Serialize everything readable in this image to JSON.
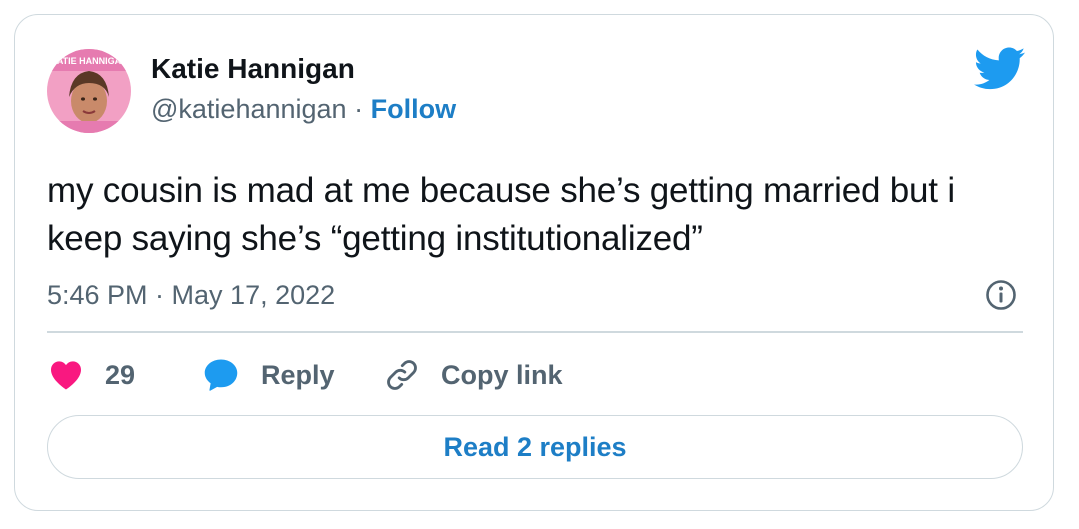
{
  "author": {
    "name": "Katie Hannigan",
    "handle": "@katiehannigan",
    "separator": "·",
    "follow_label": "Follow",
    "avatar_text": "KATIE HANNIGAN"
  },
  "tweet": {
    "text": "my cousin is mad at me because she’s getting married but i keep saying she’s “getting institutionalized”",
    "timestamp": "5:46 PM · May 17, 2022"
  },
  "actions": {
    "like_count": "29",
    "reply_label": "Reply",
    "copy_link_label": "Copy link"
  },
  "read_replies_label": "Read 2 replies",
  "colors": {
    "accent": "#1d7ec6",
    "like": "#f91880",
    "reply": "#1d9bf0",
    "border": "#cfd9de",
    "secondary_text": "#536471"
  },
  "icons": {
    "brand": "twitter-bird-icon",
    "info": "info-icon",
    "like": "heart-icon",
    "reply": "speech-bubble-icon",
    "copy": "link-icon"
  }
}
